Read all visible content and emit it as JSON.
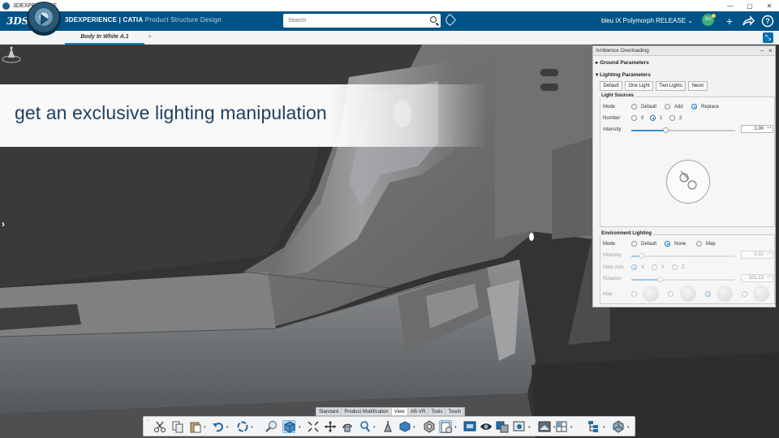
{
  "os_window": {
    "title": "3DEXPERIENCE",
    "controls": [
      "—",
      "▢",
      "✕"
    ]
  },
  "top_bar": {
    "brand_prefix": "3DEXPERIENCE | CATIA",
    "app_name": "Product Structure Design",
    "search": {
      "placeholder": "Search",
      "value": ""
    },
    "user_label": "bleu iX Polymorph RELEASE ⌄",
    "avatar_initials": "SU",
    "icons": [
      "tag-icon",
      "add-icon",
      "share-icon",
      "help-icon"
    ]
  },
  "tabs": {
    "active_label": "Body In White A.1",
    "add_label": "+"
  },
  "overlay": {
    "caption": "get an exclusive lighting manipulation"
  },
  "panel": {
    "title": "Ambience Overloading",
    "ground_parameters": "Ground Parameters",
    "lighting_parameters": "Lighting Parameters",
    "presets": [
      "Default",
      "One Light",
      "Two Lights",
      "Neon"
    ],
    "light_sources": {
      "label": "Light Sources",
      "mode_label": "Mode",
      "mode_options": [
        "Default",
        "Add",
        "Replace"
      ],
      "mode_selected": "Replace",
      "number_label": "Number",
      "number_options": [
        "0",
        "1",
        "2"
      ],
      "number_selected": "1",
      "intensity_label": "Intensity",
      "intensity_value": "1.00",
      "intensity_fraction": 0.33
    },
    "environment_lighting": {
      "label": "Environment Lighting",
      "mode_label": "Mode",
      "mode_options": [
        "Default",
        "None",
        "Map"
      ],
      "mode_selected": "None",
      "intensity_label": "Intensity",
      "intensity_value": "0.22",
      "intensity_fraction": 0.1,
      "main_axis_label": "Main Axis",
      "main_axis_options": [
        "X",
        "Y",
        "Z"
      ],
      "main_axis_selected": "X",
      "rotation_label": "Rotation",
      "rotation_value": "101.13",
      "rotation_fraction": 0.28,
      "map_label": "Map"
    }
  },
  "bottom_tabs": [
    "Standard",
    "Product Modification",
    "View",
    "AR-VR",
    "Tools",
    "Touch"
  ],
  "bottom_tabs_active": "View",
  "toolbar_icons": [
    "cut-icon",
    "copy-icon",
    "paste-icon",
    "undo-icon",
    "update-icon",
    "zoom-area-icon",
    "view-cube-icon",
    "fit-all-icon",
    "pan-icon",
    "rotate-icon",
    "zoom-icon",
    "normal-view-icon",
    "iso-view-icon",
    "render-style-icon",
    "ambience-icon",
    "capture-icon",
    "hide-show-icon",
    "swap-icon",
    "render-icon",
    "screen-split-icon",
    "tree-icon",
    "compass-icon"
  ],
  "colors": {
    "top_bar": "#005386",
    "accent": "#0a6fb8",
    "caption_text": "#1c3f5f"
  }
}
